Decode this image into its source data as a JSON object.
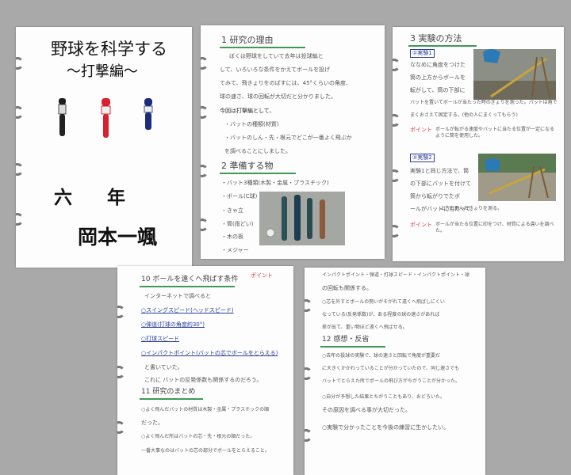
{
  "colors": {
    "background": "#a9a9a9",
    "paper": "#fdfdfd",
    "green": "#3f9a55",
    "blue": "#2b3f9a",
    "red": "#d33b4b"
  },
  "cover": {
    "title": "野球を科学する",
    "subtitle": "〜打撃編〜",
    "grade": "六 年",
    "author": "岡本一颯"
  },
  "page2": {
    "section1_heading": "1 研究の理由",
    "reason_lines": [
      "ぼくは野球をしていて去年は投球編と",
      "して、いろいろな条件をかえてボールを投げ",
      "てみて、飛きょりをのばすには、45°くらいの角度、",
      "球の速さ、球の回転が大切だと分かりました。",
      "今回は打撃編として、",
      "・バットの種類(材質)",
      "・バットのしん・先・根元でどこが一番よく飛ぶか",
      "を調べることにしました。"
    ],
    "section2_heading": "2 準備する物",
    "materials": [
      "・バット3種類(木製・金属・プラスチック)",
      "・ボール(C球)",
      "・きゃ立",
      "・筒(雨どい)",
      "・木の板",
      "・メジャー"
    ]
  },
  "page3": {
    "section3_heading": "3 実験の方法",
    "exp1_label": "①実験1",
    "exp1_lines": [
      "ななめに角度をつけた",
      "筒の上方からボールを",
      "転がして、筒の下部に",
      "バットを置いてボールが当たった時のきょりを測った。バットは角で",
      "まくおさえて固定する。(他の人にまくってもらう)"
    ],
    "point1_label": "ポイント",
    "point1_text": "ボールが転がる速度やバットに当たる位置が一定になるように筒を使用した。",
    "exp2_label": "②実験2",
    "exp2_lines": [
      "実験1と同じ方法で、筒",
      "の下部にバットを付けて",
      "筒から転がりでたボ",
      "ールがバットに当たって、",
      "上方に飛んだきょりを測る。"
    ],
    "point2_label": "ポイント",
    "point2_text": "ボールが当たる位置に印をつけ、材質による違いを調べた。"
  },
  "page4": {
    "section10_heading": "10 ボールを遠くへ飛ばす条件",
    "intro": "インターネットで調べると",
    "conditions": [
      "○スイングスピード(ヘッドスピード)",
      "○弾道(打球の角度約30°)",
      "○打球スピード",
      "○インパクトポイント(バットの芯でボールをとらえる)"
    ],
    "note_lines": [
      "と書いていた。",
      "これに バットの反発係数も関係するのだろう。"
    ],
    "section11_heading": "11 研究のまとめ",
    "summary_lines": [
      "○よく飛んだバットの材質は木製・金属・プラスチックの順",
      "だった。",
      "○よく飛んだ所はバットの芯・先・根元の順だった。",
      "一番大事なのはバットの芯の部分でボールをとらえること。"
    ],
    "stamp": "ポイント"
  },
  "page5": {
    "top_lines": [
      "インパクトポイント・弾道・打球スピード・インパクトポイント・球",
      "の回転も関係する。"
    ],
    "body_lines": [
      "○芯を外すとボールの勢いがそがれて遠くへ飛ばしにくい",
      "なっている(反発係数)が、ある程度の球の速さがあれば",
      "差が出て、重い物ほど遠くへ飛ばせる。"
    ],
    "section12_heading": "12 感想・反省",
    "reflection_lines": [
      "○去年の投球の実験で、球の速さと回転で角度が重要だ",
      "に大きくかかわっていることが分かっていたので、同じ速さでも",
      "バットでとらえた所でボールの飛び方がちがうことが分かった。",
      "○自分が予想した結果とちがうこともあり、おどろいた。",
      "その原因を調べる事が大切だった。",
      "○実験で分かったことを今後の練習に生かしたい。"
    ]
  }
}
